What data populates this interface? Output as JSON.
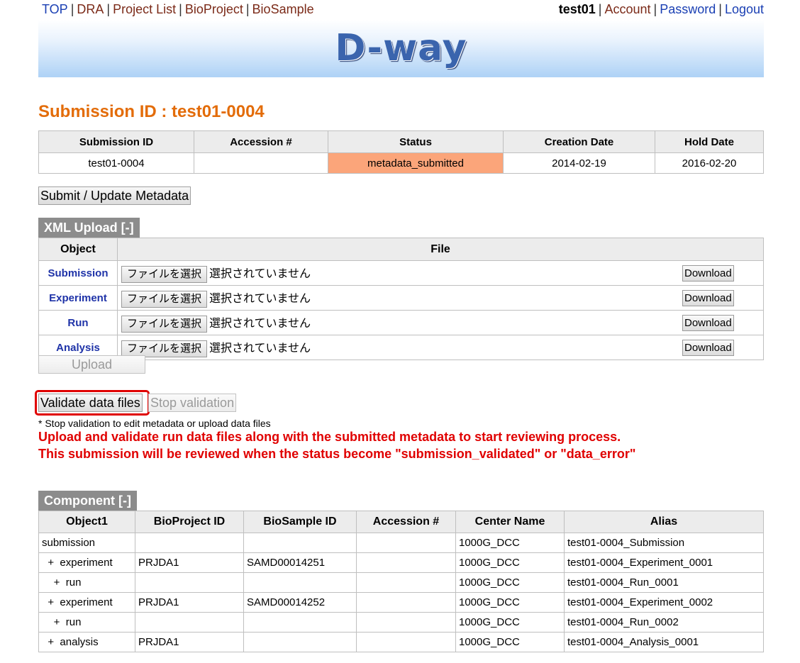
{
  "nav": {
    "left": [
      "TOP",
      "DRA",
      "Project List",
      "BioProject",
      "BioSample"
    ],
    "user": "test01",
    "right": [
      "Account",
      "Password",
      "Logout"
    ]
  },
  "logo_text": "D-way",
  "title": "Submission ID : test01-0004",
  "submission_table": {
    "headers": [
      "Submission ID",
      "Accession #",
      "Status",
      "Creation Date",
      "Hold Date"
    ],
    "row": [
      "test01-0004",
      "",
      "metadata_submitted",
      "2014-02-19",
      "2016-02-20"
    ]
  },
  "submit_button": "Submit / Update Metadata",
  "xml_upload": {
    "tab": "XML Upload [-]",
    "headers": [
      "Object",
      "File"
    ],
    "choose_label": "ファイルを選択",
    "none_label": "選択されていません",
    "download_label": "Download",
    "rows": [
      "Submission",
      "Experiment",
      "Run",
      "Analysis"
    ],
    "upload_label": "Upload"
  },
  "validate_button": "Validate data files",
  "stop_button": "Stop validation",
  "note": "* Stop validation to edit metadata or upload data files",
  "warning1": "Upload and validate run data files along with the submitted metadata to start reviewing process.",
  "warning2": "This submission will be reviewed when the status become \"submission_validated\" or \"data_error\"",
  "component": {
    "tab": "Component [-]",
    "headers": [
      "Object1",
      "BioProject ID",
      "BioSample ID",
      "Accession #",
      "Center Name",
      "Alias"
    ],
    "rows": [
      [
        "submission",
        "",
        "",
        "",
        "1000G_DCC",
        "test01-0004_Submission"
      ],
      [
        "  +  experiment",
        "PRJDA1",
        "SAMD00014251",
        "",
        "1000G_DCC",
        "test01-0004_Experiment_0001"
      ],
      [
        "    +  run",
        "",
        "",
        "",
        "1000G_DCC",
        "test01-0004_Run_0001"
      ],
      [
        "  +  experiment",
        "PRJDA1",
        "SAMD00014252",
        "",
        "1000G_DCC",
        "test01-0004_Experiment_0002"
      ],
      [
        "    +  run",
        "",
        "",
        "",
        "1000G_DCC",
        "test01-0004_Run_0002"
      ],
      [
        "  +  analysis",
        "PRJDA1",
        "",
        "",
        "1000G_DCC",
        "test01-0004_Analysis_0001"
      ]
    ]
  },
  "colors": {
    "title": "#e36c09",
    "status_bg": "#fba57a",
    "warning": "#e00000",
    "link": "#1a3fb3",
    "link_visited": "#7b2a18",
    "tab_bg": "#8c8c8c"
  }
}
